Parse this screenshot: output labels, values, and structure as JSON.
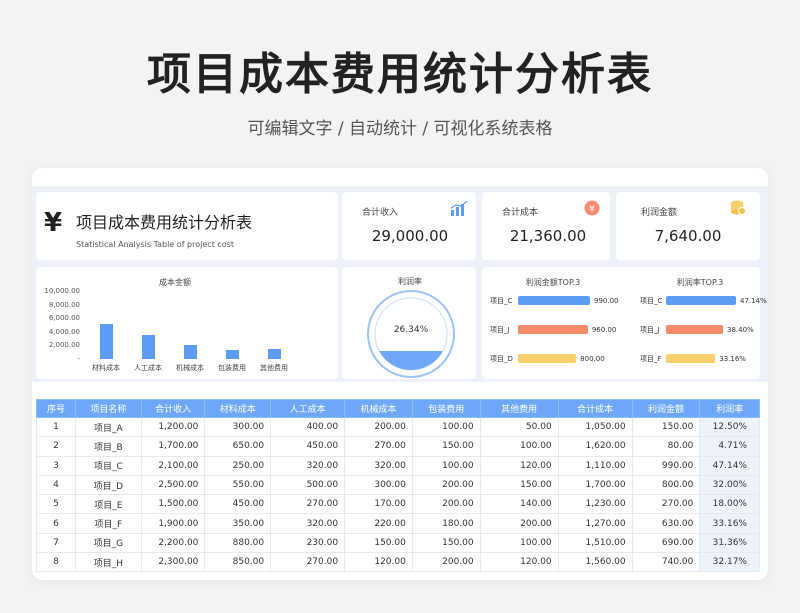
{
  "header": {
    "title": "项目成本费用统计分析表",
    "subtitle": "可编辑文字 / 自动统计 / 可视化系统表格"
  },
  "panel": {
    "currency_symbol": "¥",
    "title": "项目成本费用统计分析表",
    "subtitle_en": "Statistical Analysis Table of project cost"
  },
  "kpis": [
    {
      "label": "合计收入",
      "value": "29,000.00",
      "icon": "bar-chart-icon"
    },
    {
      "label": "合计成本",
      "value": "21,360.00",
      "icon": "yen-coin-icon"
    },
    {
      "label": "利润金额",
      "value": "7,640.00",
      "icon": "coin-stack-icon"
    }
  ],
  "colors": {
    "blue": "#5b9cf5",
    "orange": "#f58b6a",
    "yellow": "#f7cf6b",
    "header": "#6ea7f7"
  },
  "chart_data": [
    {
      "type": "bar",
      "title": "成本金额",
      "categories": [
        "材料成本",
        "人工成本",
        "机械成本",
        "包装费用",
        "其他费用"
      ],
      "values": [
        5090,
        3570,
        2000,
        1300,
        1400
      ],
      "yticks": [
        "10,000.00",
        "8,000.00",
        "6,000.00",
        "4,000.00",
        "2,000.00",
        "-"
      ],
      "ylim": [
        0,
        10000
      ]
    },
    {
      "type": "gauge",
      "title": "利润率",
      "value": 26.34,
      "label": "26.34%"
    },
    {
      "type": "bar",
      "orientation": "horizontal",
      "title": "利润金额TOP.3",
      "categories": [
        "项目_C",
        "项目_J",
        "项目_D"
      ],
      "values": [
        990,
        960,
        800
      ],
      "labels": [
        "990.00",
        "960.00",
        "800.00"
      ]
    },
    {
      "type": "bar",
      "orientation": "horizontal",
      "title": "利润率TOP.3",
      "categories": [
        "项目_C",
        "项目_J",
        "项目_F"
      ],
      "values": [
        47.14,
        38.4,
        33.16
      ],
      "labels": [
        "47.14%",
        "38.40%",
        "33.16%"
      ]
    }
  ],
  "table": {
    "headers": [
      "序号",
      "项目名称",
      "合计收入",
      "材料成本",
      "人工成本",
      "机械成本",
      "包装费用",
      "其他费用",
      "合计成本",
      "利润金额",
      "利润率"
    ],
    "rows": [
      [
        "1",
        "项目_A",
        "1,200.00",
        "300.00",
        "400.00",
        "200.00",
        "100.00",
        "50.00",
        "1,050.00",
        "150.00",
        "12.50%"
      ],
      [
        "2",
        "项目_B",
        "1,700.00",
        "650.00",
        "450.00",
        "270.00",
        "150.00",
        "100.00",
        "1,620.00",
        "80.00",
        "4.71%"
      ],
      [
        "3",
        "项目_C",
        "2,100.00",
        "250.00",
        "320.00",
        "320.00",
        "100.00",
        "120.00",
        "1,110.00",
        "990.00",
        "47.14%"
      ],
      [
        "4",
        "项目_D",
        "2,500.00",
        "550.00",
        "500.00",
        "300.00",
        "200.00",
        "150.00",
        "1,700.00",
        "800.00",
        "32.00%"
      ],
      [
        "5",
        "项目_E",
        "1,500.00",
        "450.00",
        "270.00",
        "170.00",
        "200.00",
        "140.00",
        "1,230.00",
        "270.00",
        "18.00%"
      ],
      [
        "6",
        "项目_F",
        "1,900.00",
        "350.00",
        "320.00",
        "220.00",
        "180.00",
        "200.00",
        "1,270.00",
        "630.00",
        "33.16%"
      ],
      [
        "7",
        "项目_G",
        "2,200.00",
        "880.00",
        "230.00",
        "150.00",
        "150.00",
        "100.00",
        "1,510.00",
        "690.00",
        "31.36%"
      ],
      [
        "8",
        "项目_H",
        "2,300.00",
        "850.00",
        "270.00",
        "120.00",
        "200.00",
        "120.00",
        "1,560.00",
        "740.00",
        "32.17%"
      ]
    ]
  }
}
